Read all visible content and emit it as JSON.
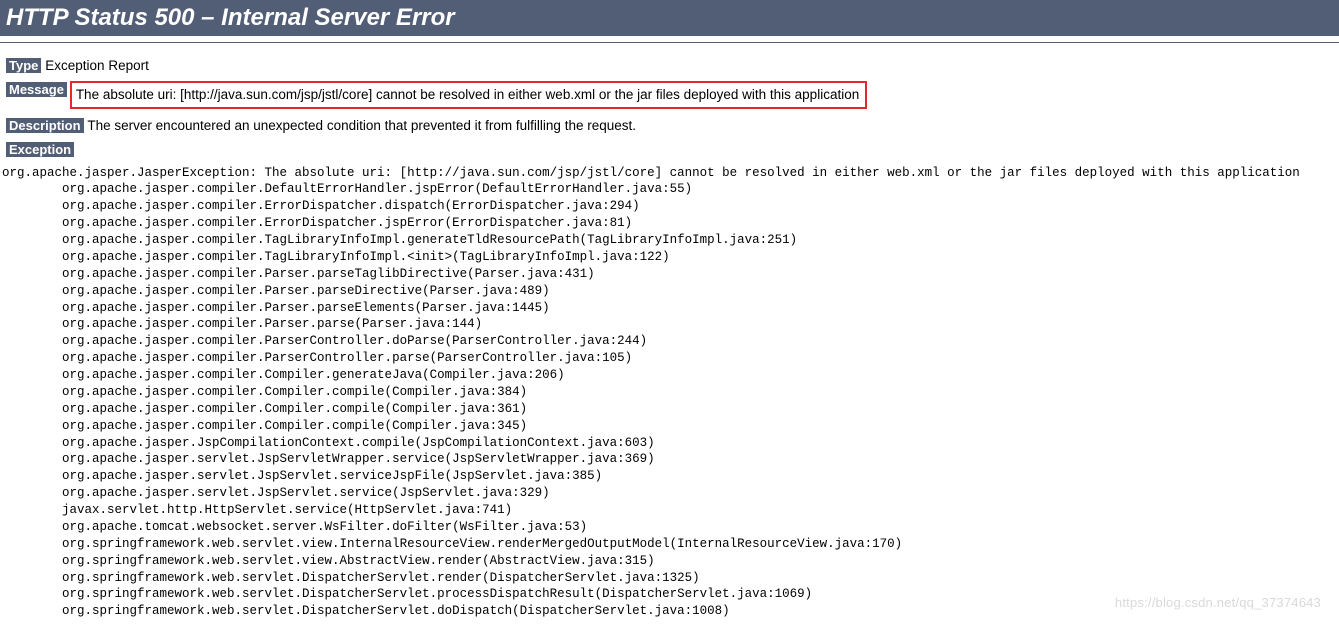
{
  "header": {
    "title": "HTTP Status 500 – Internal Server Error"
  },
  "type": {
    "label": "Type",
    "value": "Exception Report"
  },
  "message": {
    "label": "Message",
    "value": "The absolute uri: [http://java.sun.com/jsp/jstl/core] cannot be resolved in either web.xml or the jar files deployed with this application"
  },
  "description": {
    "label": "Description",
    "value": "The server encountered an unexpected condition that prevented it from fulfilling the request."
  },
  "exception": {
    "label": "Exception",
    "trace": "org.apache.jasper.JasperException: The absolute uri: [http://java.sun.com/jsp/jstl/core] cannot be resolved in either web.xml or the jar files deployed with this application\n        org.apache.jasper.compiler.DefaultErrorHandler.jspError(DefaultErrorHandler.java:55)\n        org.apache.jasper.compiler.ErrorDispatcher.dispatch(ErrorDispatcher.java:294)\n        org.apache.jasper.compiler.ErrorDispatcher.jspError(ErrorDispatcher.java:81)\n        org.apache.jasper.compiler.TagLibraryInfoImpl.generateTldResourcePath(TagLibraryInfoImpl.java:251)\n        org.apache.jasper.compiler.TagLibraryInfoImpl.<init>(TagLibraryInfoImpl.java:122)\n        org.apache.jasper.compiler.Parser.parseTaglibDirective(Parser.java:431)\n        org.apache.jasper.compiler.Parser.parseDirective(Parser.java:489)\n        org.apache.jasper.compiler.Parser.parseElements(Parser.java:1445)\n        org.apache.jasper.compiler.Parser.parse(Parser.java:144)\n        org.apache.jasper.compiler.ParserController.doParse(ParserController.java:244)\n        org.apache.jasper.compiler.ParserController.parse(ParserController.java:105)\n        org.apache.jasper.compiler.Compiler.generateJava(Compiler.java:206)\n        org.apache.jasper.compiler.Compiler.compile(Compiler.java:384)\n        org.apache.jasper.compiler.Compiler.compile(Compiler.java:361)\n        org.apache.jasper.compiler.Compiler.compile(Compiler.java:345)\n        org.apache.jasper.JspCompilationContext.compile(JspCompilationContext.java:603)\n        org.apache.jasper.servlet.JspServletWrapper.service(JspServletWrapper.java:369)\n        org.apache.jasper.servlet.JspServlet.serviceJspFile(JspServlet.java:385)\n        org.apache.jasper.servlet.JspServlet.service(JspServlet.java:329)\n        javax.servlet.http.HttpServlet.service(HttpServlet.java:741)\n        org.apache.tomcat.websocket.server.WsFilter.doFilter(WsFilter.java:53)\n        org.springframework.web.servlet.view.InternalResourceView.renderMergedOutputModel(InternalResourceView.java:170)\n        org.springframework.web.servlet.view.AbstractView.render(AbstractView.java:315)\n        org.springframework.web.servlet.DispatcherServlet.render(DispatcherServlet.java:1325)\n        org.springframework.web.servlet.DispatcherServlet.processDispatchResult(DispatcherServlet.java:1069)\n        org.springframework.web.servlet.DispatcherServlet.doDispatch(DispatcherServlet.java:1008)"
  },
  "watermark": "https://blog.csdn.net/qq_37374643"
}
